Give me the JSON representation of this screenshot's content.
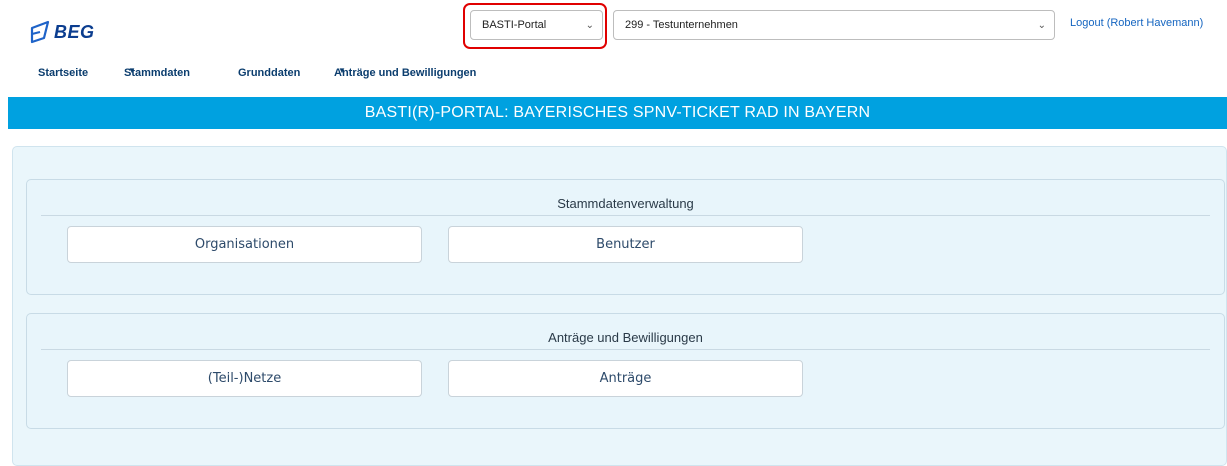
{
  "header": {
    "logo_text": "BEG",
    "portal_select": {
      "value": "BASTI-Portal"
    },
    "company_select": {
      "value": "299 - Testunternehmen"
    },
    "logout_label": "Logout (Robert Havemann)"
  },
  "nav": {
    "items": [
      {
        "label": "Startseite"
      },
      {
        "label": "Stammdaten"
      },
      {
        "label": "Grunddaten"
      },
      {
        "label": "Anträge und Bewilligungen"
      }
    ]
  },
  "banner": {
    "title": "BASTI(R)-PORTAL: BAYERISCHES SPNV-TICKET RAD IN BAYERN"
  },
  "sections": [
    {
      "title": "Stammdatenverwaltung",
      "buttons": [
        {
          "label": "Organisationen"
        },
        {
          "label": "Benutzer"
        }
      ]
    },
    {
      "title": "Anträge und Bewilligungen",
      "buttons": [
        {
          "label": "(Teil-)Netze"
        },
        {
          "label": "Anträge"
        }
      ]
    }
  ],
  "colors": {
    "banner": "#00a1e0",
    "highlight": "#e00000",
    "nav_text": "#0b3d6e"
  }
}
